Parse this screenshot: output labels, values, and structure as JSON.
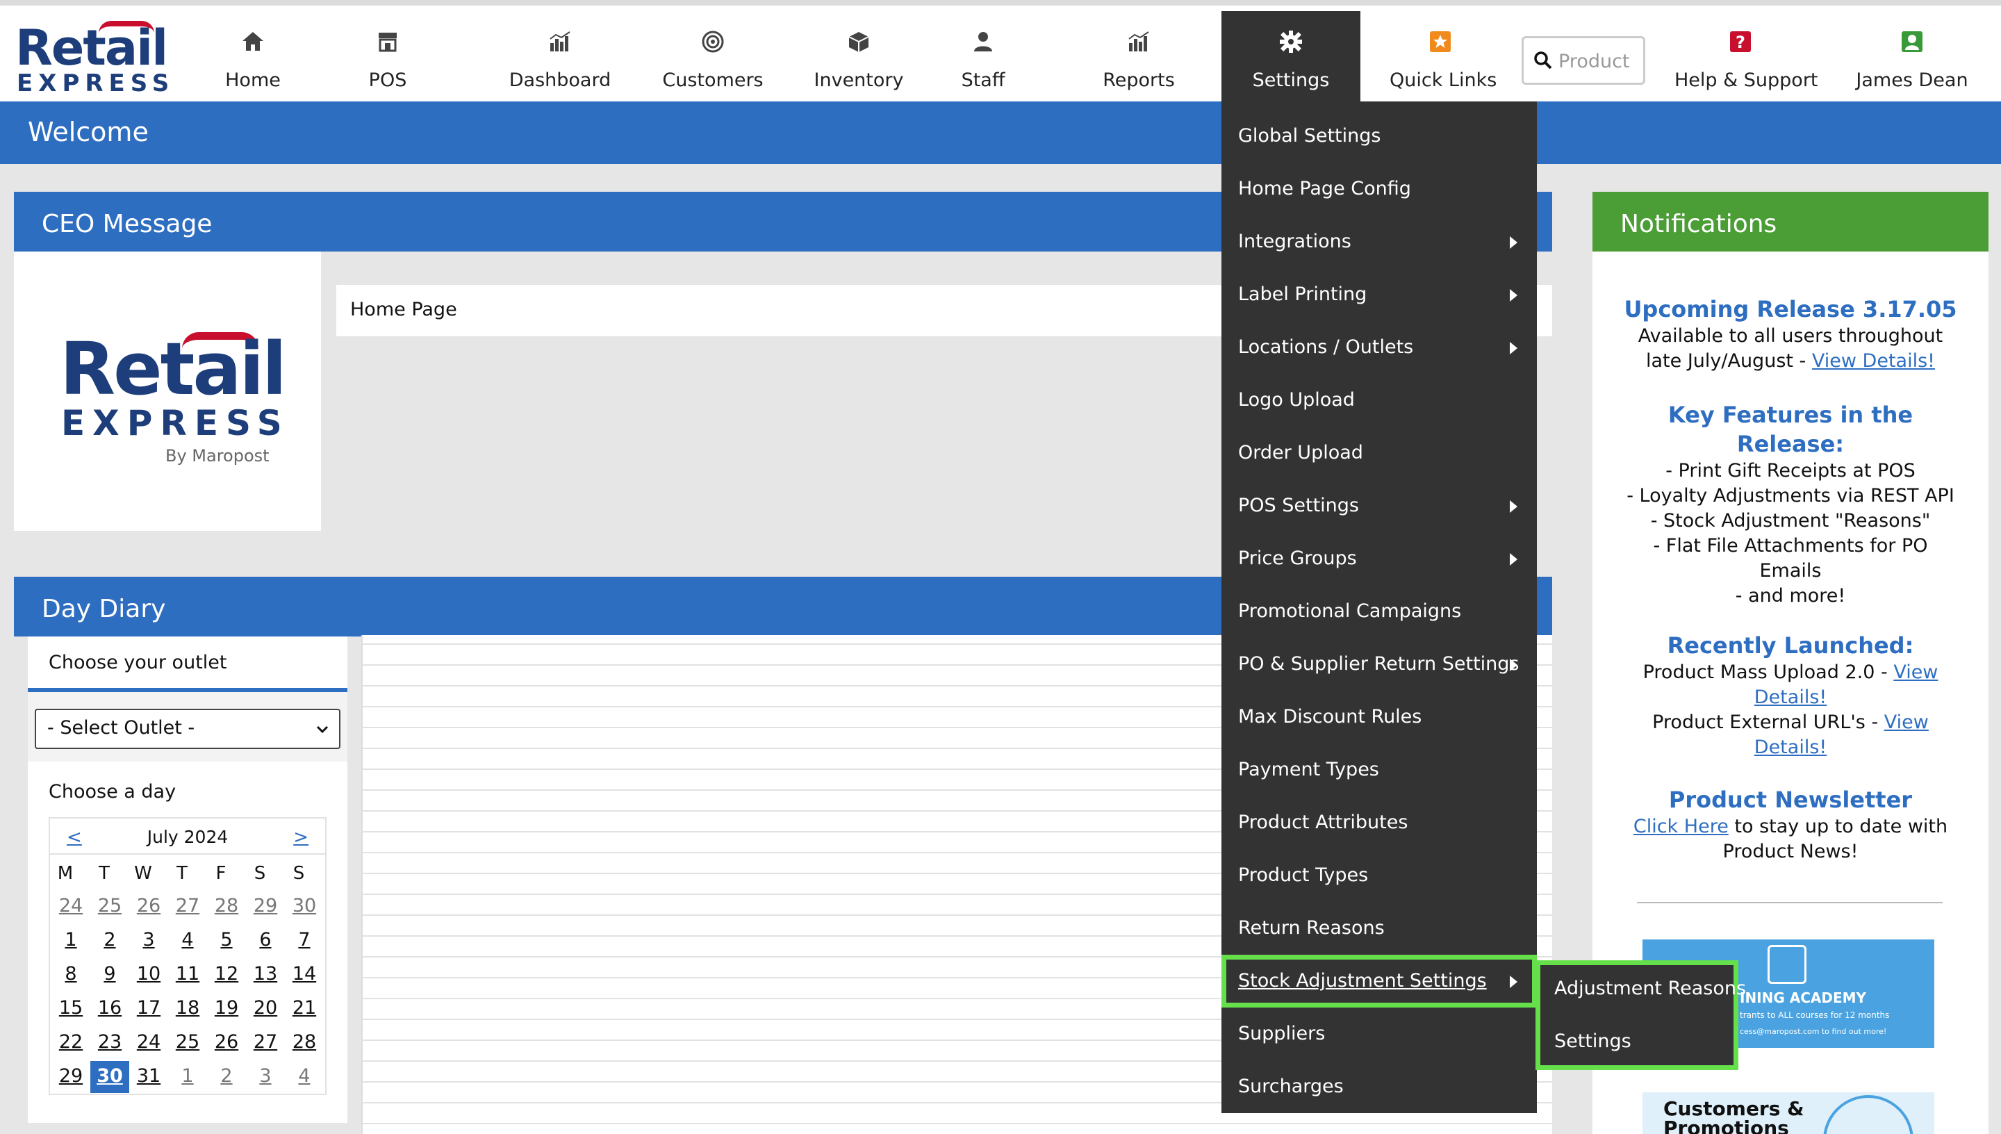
{
  "nav": {
    "home": "Home",
    "pos": "POS",
    "dashboard": "Dashboard",
    "customers": "Customers",
    "inventory": "Inventory",
    "staff": "Staff",
    "reports": "Reports",
    "settings": "Settings",
    "quick_links": "Quick Links",
    "search_placeholder": "Product",
    "help": "Help & Support",
    "user": "James Dean"
  },
  "brand": {
    "logo_top": "Retail",
    "logo_bottom": "EXPRESS",
    "logo_by": "By Maropost"
  },
  "welcome": "Welcome",
  "ceo": {
    "title": "CEO Message",
    "tab": "Home Page"
  },
  "diary": {
    "title": "Day Diary",
    "outlet_label": "Choose your outlet",
    "outlet_value": "- Select Outlet -",
    "day_label": "Choose a day",
    "calendar": {
      "prev": "<",
      "next": ">",
      "month": "July 2024",
      "dow": [
        "M",
        "T",
        "W",
        "T",
        "F",
        "S",
        "S"
      ],
      "weeks": [
        [
          "24",
          "25",
          "26",
          "27",
          "28",
          "29",
          "30"
        ],
        [
          "1",
          "2",
          "3",
          "4",
          "5",
          "6",
          "7"
        ],
        [
          "8",
          "9",
          "10",
          "11",
          "12",
          "13",
          "14"
        ],
        [
          "15",
          "16",
          "17",
          "18",
          "19",
          "20",
          "21"
        ],
        [
          "22",
          "23",
          "24",
          "25",
          "26",
          "27",
          "28"
        ],
        [
          "29",
          "30",
          "31",
          "1",
          "2",
          "3",
          "4"
        ]
      ],
      "selected": "30"
    }
  },
  "notifications": {
    "title": "Notifications",
    "release_title": "Upcoming Release 3.17.05",
    "release_line1": "Available to all users throughout",
    "release_line2": "late July/August -",
    "release_link": "View Details!",
    "features_title1": "Key Features in the",
    "features_title2": "Release:",
    "features": [
      "- Print Gift Receipts at POS",
      "- Loyalty Adjustments via REST API",
      "- Stock Adjustment \"Reasons\"",
      "- Flat File Attachments for PO",
      "Emails",
      "- and more!"
    ],
    "launched_title": "Recently Launched:",
    "launched1_text": "Product Mass Upload 2.0 -",
    "launched1_link_a": "View",
    "launched1_link_b": "Details!",
    "launched2_text": "Product External URL's -",
    "launched2_link_a": "View",
    "launched2_link_b": "Details!",
    "newsletter_title": "Product Newsletter",
    "newsletter_link": "Click Here",
    "newsletter_text1": "to stay up to date with",
    "newsletter_text2": "Product News!",
    "banner1_title": "INING ACADEMY",
    "banner1_line": "trants to ALL courses for 12 months",
    "banner1_small": "cess@maropost.com to find out more!",
    "banner2_title": "Customers & Promotions"
  },
  "settings_menu": {
    "items": [
      {
        "label": "Global Settings",
        "arrow": false
      },
      {
        "label": "Home Page Config",
        "arrow": false
      },
      {
        "label": "Integrations",
        "arrow": true
      },
      {
        "label": "Label Printing",
        "arrow": true
      },
      {
        "label": "Locations / Outlets",
        "arrow": true
      },
      {
        "label": "Logo Upload",
        "arrow": false
      },
      {
        "label": "Order Upload",
        "arrow": false
      },
      {
        "label": "POS Settings",
        "arrow": true
      },
      {
        "label": "Price Groups",
        "arrow": true
      },
      {
        "label": "Promotional Campaigns",
        "arrow": false
      },
      {
        "label": "PO & Supplier Return Settings",
        "arrow": true
      },
      {
        "label": "Max Discount Rules",
        "arrow": false
      },
      {
        "label": "Payment Types",
        "arrow": false
      },
      {
        "label": "Product Attributes",
        "arrow": false
      },
      {
        "label": "Product Types",
        "arrow": false
      },
      {
        "label": "Return Reasons",
        "arrow": false
      },
      {
        "label": "Stock Adjustment Settings",
        "arrow": true
      },
      {
        "label": "Suppliers",
        "arrow": false
      },
      {
        "label": "Surcharges",
        "arrow": false
      }
    ],
    "highlighted": "Stock Adjustment Settings",
    "submenu": [
      "Adjustment Reasons",
      "Settings"
    ]
  },
  "colors": {
    "primary_blue": "#2e6ec1",
    "notifications_green": "#4a9e35",
    "menu_bg": "#333333",
    "highlight_green": "#66e04a"
  }
}
